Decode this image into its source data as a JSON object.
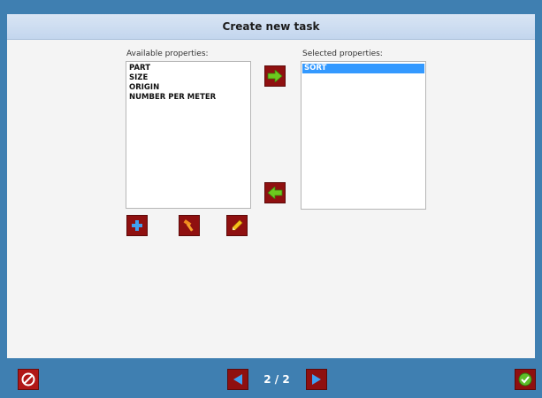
{
  "dialog": {
    "title": "Create new task"
  },
  "available": {
    "label": "Available properties:",
    "items": [
      "PART",
      "SIZE",
      "ORIGIN",
      "NUMBER PER METER"
    ]
  },
  "selected": {
    "label": "Selected properties:",
    "items": [
      "SORT"
    ],
    "highlighted_index": 0
  },
  "actions": {
    "move_right_icon": "arrow-right-icon",
    "move_left_icon": "arrow-left-icon",
    "add_icon": "plus-icon",
    "delete_icon": "hammer-icon",
    "edit_icon": "pencil-icon"
  },
  "footer": {
    "page_indicator": "2 / 2",
    "cancel_icon": "cancel-icon",
    "prev_icon": "triangle-left-icon",
    "next_icon": "triangle-right-icon",
    "confirm_icon": "checkmark-icon"
  },
  "colors": {
    "frame": "#3f7fb1",
    "button_red": "#8f1010",
    "arrow_green": "#6cc91e",
    "selection": "#3399ff"
  }
}
